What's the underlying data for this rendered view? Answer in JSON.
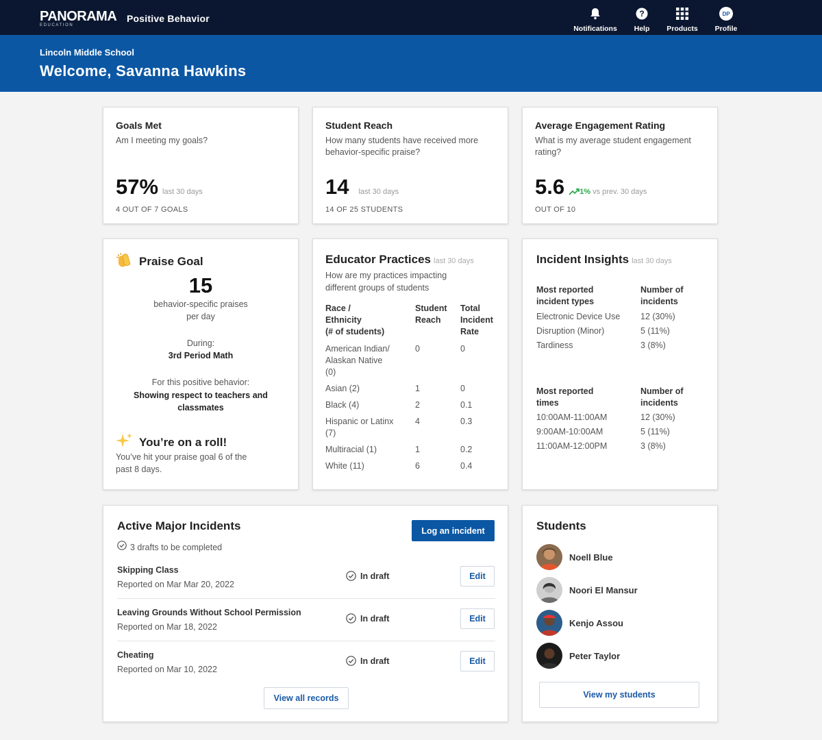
{
  "nav": {
    "logo": "PANORAMA",
    "logo_sub": "EDUCATION",
    "app_name": "Positive Behavior",
    "items": [
      {
        "label": "Notifications",
        "icon": "bell-icon"
      },
      {
        "label": "Help",
        "icon": "help-icon"
      },
      {
        "label": "Products",
        "icon": "grid-icon"
      },
      {
        "label": "Profile",
        "icon": "avatar",
        "initials": "DP"
      }
    ]
  },
  "header": {
    "school": "Lincoln Middle School",
    "welcome": "Welcome, Savanna Hawkins"
  },
  "stats": [
    {
      "title": "Goals Met",
      "question": "Am I meeting my goals?",
      "value": "57%",
      "period": "last 30 days",
      "footer": "4 OUT OF 7 GOALS"
    },
    {
      "title": "Student Reach",
      "question": "How many students have received more behavior-specific praise?",
      "value": "14",
      "period": "last 30 days",
      "footer": "14 OF 25 STUDENTS"
    },
    {
      "title": "Average Engagement Rating",
      "question": "What is my average student engagement rating?",
      "value": "5.6",
      "trend": "1%",
      "trend_text": "vs prev. 30 days",
      "footer": "OUT OF 10"
    }
  ],
  "praise_goal": {
    "title": "Praise Goal",
    "count": "15",
    "line1": "behavior-specific praises",
    "line2": "per day",
    "during_label": "During:",
    "during_value": "3rd Period Math",
    "behavior_label": "For this positive behavior:",
    "behavior_value_1": "Showing respect to teachers and",
    "behavior_value_2": "classmates",
    "roll_title": "You’re on a roll!",
    "roll_text_1": "You’ve hit your praise goal 6 of the",
    "roll_text_2": "past 8 days."
  },
  "educator": {
    "title": "Educator Practices",
    "period": "last 30 days",
    "question_1": "How are my practices impacting",
    "question_2": "different groups of students",
    "headers": {
      "c1": [
        "Race /",
        "Ethnicity",
        "(# of students)"
      ],
      "c2": [
        "Student",
        "Reach"
      ],
      "c3": [
        "Total",
        "Incident",
        "Rate"
      ]
    },
    "rows": [
      {
        "group": [
          "American Indian/",
          "Alaskan Native",
          "(0)"
        ],
        "reach": "0",
        "rate": "0"
      },
      {
        "group": [
          "Asian (2)"
        ],
        "reach": "1",
        "rate": "0"
      },
      {
        "group": [
          "Black (4)"
        ],
        "reach": "2",
        "rate": "0.1"
      },
      {
        "group": [
          "Hispanic or Latinx",
          "(7)"
        ],
        "reach": "4",
        "rate": "0.3"
      },
      {
        "group": [
          "Multiracial (1)"
        ],
        "reach": "1",
        "rate": "0.2"
      },
      {
        "group": [
          "White (11)"
        ],
        "reach": "6",
        "rate": "0.4"
      }
    ]
  },
  "insights": {
    "title": "Incident Insights",
    "period": "last 30 days",
    "types_header": [
      "Most reported",
      "incident types"
    ],
    "types_count_header": [
      "Number of",
      "incidents"
    ],
    "types": [
      {
        "label": "Electronic Device Use",
        "count": "12 (30%)"
      },
      {
        "label": "Disruption (Minor)",
        "count": "5 (11%)"
      },
      {
        "label": "Tardiness",
        "count": "3 (8%)"
      }
    ],
    "times_header": [
      "Most reported",
      "times"
    ],
    "times_count_header": [
      "Number of",
      "incidents"
    ],
    "times": [
      {
        "label": "10:00AM-11:00AM",
        "count": "12 (30%)"
      },
      {
        "label": "9:00AM-10:00AM",
        "count": "5 (11%)"
      },
      {
        "label": "11:00AM-12:00PM",
        "count": "3 (8%)"
      }
    ]
  },
  "incidents": {
    "title": "Active Major Incidents",
    "drafts": "3 drafts to be completed",
    "log_button": "Log an incident",
    "rows": [
      {
        "title": "Skipping Class",
        "reported": "Reported on Mar Mar 20, 2022",
        "status": "In draft",
        "action": "Edit"
      },
      {
        "title": "Leaving Grounds Without School Permission",
        "reported": "Reported on Mar 18, 2022",
        "status": "In draft",
        "action": "Edit"
      },
      {
        "title": "Cheating",
        "reported": "Reported on Mar 10, 2022",
        "status": "In draft",
        "action": "Edit"
      }
    ],
    "view_all": "View all records"
  },
  "students": {
    "title": "Students",
    "list": [
      {
        "name": "Noell Blue"
      },
      {
        "name": "Noori El Mansur"
      },
      {
        "name": "Kenjo Assou"
      },
      {
        "name": "Peter Taylor"
      }
    ],
    "view_button": "View my students"
  },
  "colors": {
    "nav_bg": "#0b1730",
    "banner_bg": "#0b57a4",
    "accent": "#1a5aa6",
    "trend_up": "#2fa84f"
  }
}
